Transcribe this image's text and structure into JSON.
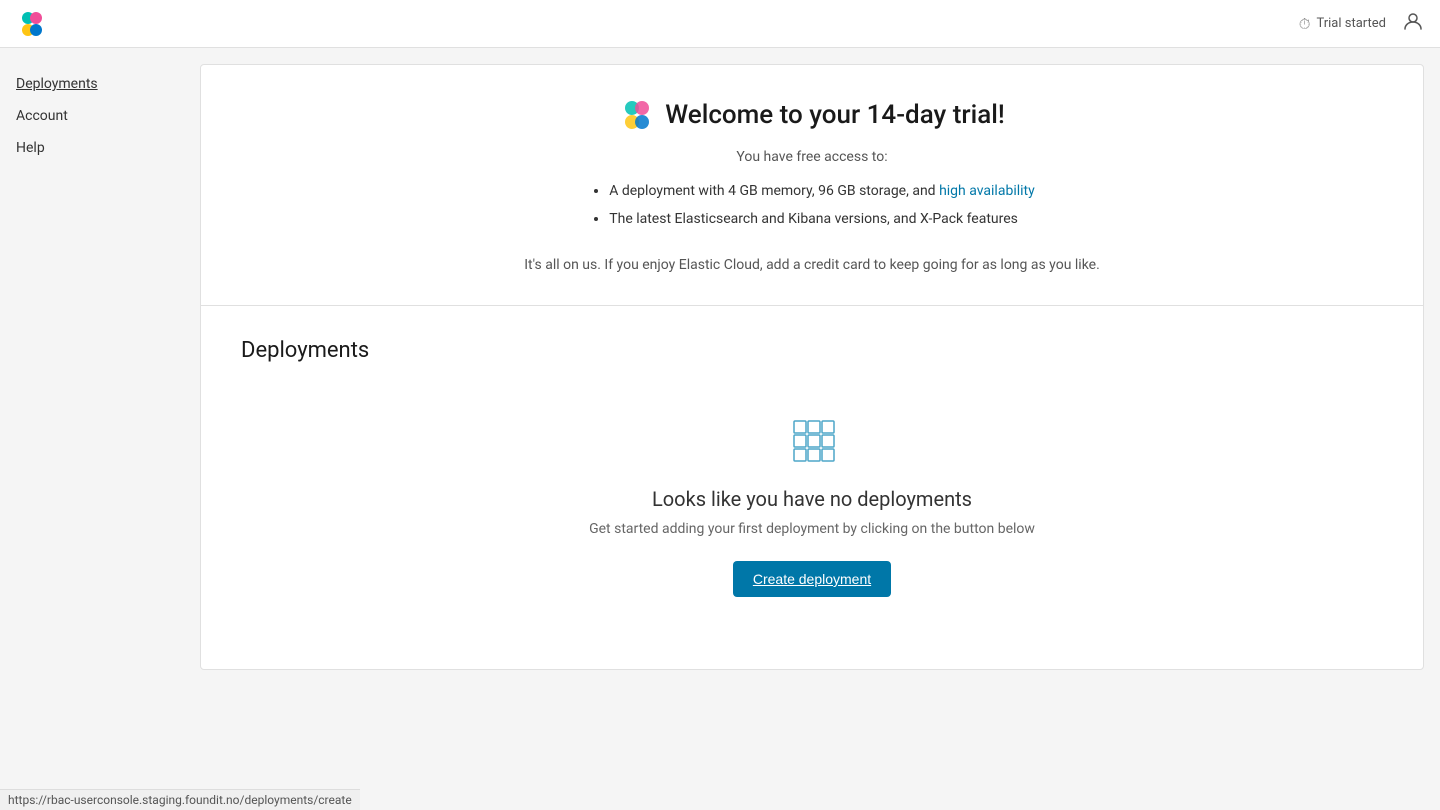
{
  "header": {
    "trial_label": "Trial started",
    "logo_alt": "Elastic Cloud Logo"
  },
  "sidebar": {
    "items": [
      {
        "label": "Deployments",
        "active": true,
        "name": "deployments"
      },
      {
        "label": "Account",
        "active": false,
        "name": "account"
      },
      {
        "label": "Help",
        "active": false,
        "name": "help"
      }
    ]
  },
  "trial_banner": {
    "title": "Welcome to your 14-day trial!",
    "subtitle": "You have free access to:",
    "features": [
      {
        "text": "A deployment with 4 GB memory, 96 GB storage, and ",
        "highlight": "high availability"
      },
      {
        "text": "The latest Elasticsearch and Kibana versions, and X-Pack features",
        "highlight": null
      }
    ],
    "note": "It's all on us. If you enjoy Elastic Cloud, add a credit card to keep going for as long as you like."
  },
  "deployments": {
    "section_title": "Deployments",
    "empty_title": "Looks like you have no deployments",
    "empty_subtitle": "Get started adding your first deployment by clicking on the button below",
    "create_button_label": "Create deployment"
  },
  "status_bar": {
    "url": "https://rbac-userconsole.staging.foundit.no/deployments/create"
  },
  "icons": {
    "trial": "⏱",
    "user": "👤",
    "grid": "grid"
  }
}
